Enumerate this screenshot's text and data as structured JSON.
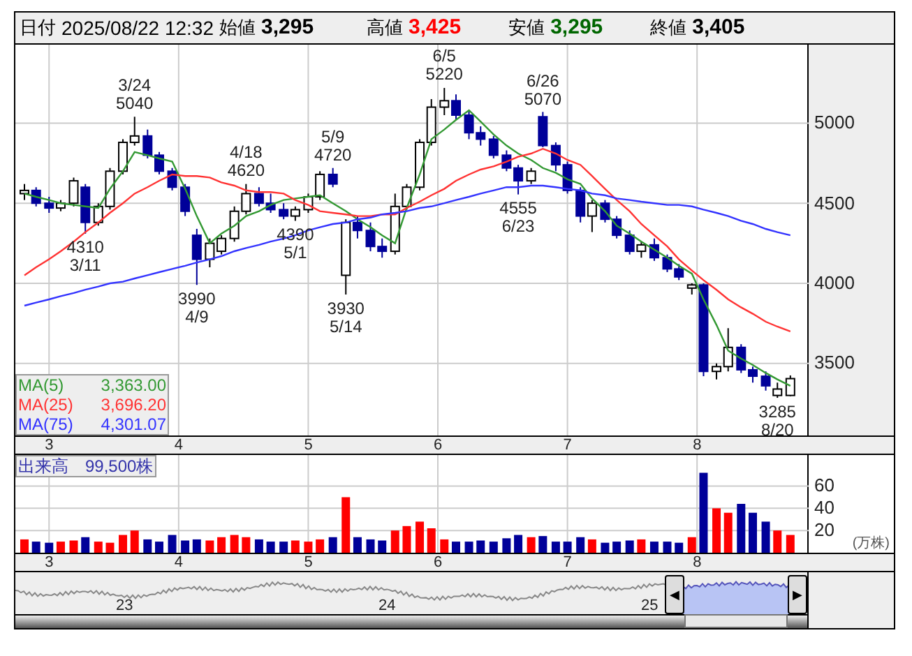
{
  "header": {
    "fields": [
      {
        "label": "日付",
        "value": "2025/08/22 12:32",
        "kind": "date"
      },
      {
        "label": "始値",
        "value": "3,295",
        "kind": "open"
      },
      {
        "label": "高値",
        "value": "3,425",
        "kind": "high"
      },
      {
        "label": "安値",
        "value": "3,295",
        "kind": "low"
      },
      {
        "label": "終値",
        "value": "3,405",
        "kind": "close"
      }
    ]
  },
  "price_chart": {
    "chart_data": {
      "type": "candlestick",
      "grid": true,
      "xlim": [
        2.74,
        9.54
      ],
      "ylim": [
        3050,
        5490
      ],
      "yticks": [
        3500,
        4000,
        4500,
        5000
      ],
      "xticks": [
        3,
        4,
        5,
        6,
        7,
        8
      ],
      "x": [
        2.81,
        2.9,
        3.0,
        3.09,
        3.19,
        3.28,
        3.38,
        3.47,
        3.57,
        3.66,
        3.76,
        3.85,
        3.95,
        4.05,
        4.14,
        4.24,
        4.33,
        4.43,
        4.52,
        4.62,
        4.71,
        4.81,
        4.9,
        5.0,
        5.09,
        5.19,
        5.29,
        5.38,
        5.48,
        5.57,
        5.67,
        5.76,
        5.86,
        5.95,
        6.05,
        6.14,
        6.24,
        6.33,
        6.43,
        6.53,
        6.62,
        6.72,
        6.81,
        6.91,
        7.0,
        7.1,
        7.19,
        7.29,
        7.38,
        7.48,
        7.57,
        7.67,
        7.77,
        7.86,
        7.96,
        8.05,
        8.15,
        8.24,
        8.34,
        8.43,
        8.53,
        8.62,
        8.72
      ],
      "ohlc": [
        [
          4560,
          4620,
          4520,
          4580
        ],
        [
          4580,
          4600,
          4480,
          4500
        ],
        [
          4500,
          4540,
          4440,
          4470
        ],
        [
          4470,
          4520,
          4450,
          4500
        ],
        [
          4500,
          4660,
          4480,
          4640
        ],
        [
          4600,
          4620,
          4310,
          4380
        ],
        [
          4380,
          4500,
          4360,
          4480
        ],
        [
          4480,
          4720,
          4460,
          4700
        ],
        [
          4700,
          4900,
          4680,
          4880
        ],
        [
          4880,
          5040,
          4860,
          4920
        ],
        [
          4920,
          4960,
          4780,
          4800
        ],
        [
          4800,
          4820,
          4680,
          4700
        ],
        [
          4700,
          4720,
          4580,
          4600
        ],
        [
          4600,
          4620,
          4420,
          4450
        ],
        [
          4300,
          4340,
          3990,
          4150
        ],
        [
          4150,
          4280,
          4100,
          4250
        ],
        [
          4200,
          4300,
          4180,
          4280
        ],
        [
          4280,
          4480,
          4260,
          4450
        ],
        [
          4450,
          4620,
          4430,
          4560
        ],
        [
          4560,
          4600,
          4480,
          4500
        ],
        [
          4500,
          4560,
          4440,
          4460
        ],
        [
          4460,
          4500,
          4400,
          4420
        ],
        [
          4420,
          4480,
          4390,
          4460
        ],
        [
          4460,
          4560,
          4440,
          4540
        ],
        [
          4540,
          4700,
          4520,
          4680
        ],
        [
          4680,
          4720,
          4600,
          4620
        ],
        [
          4050,
          4400,
          3930,
          4380
        ],
        [
          4380,
          4420,
          4280,
          4330
        ],
        [
          4330,
          4380,
          4200,
          4230
        ],
        [
          4230,
          4280,
          4160,
          4200
        ],
        [
          4200,
          4560,
          4180,
          4480
        ],
        [
          4480,
          4620,
          4460,
          4600
        ],
        [
          4600,
          4900,
          4580,
          4880
        ],
        [
          4880,
          5150,
          4860,
          5100
        ],
        [
          5100,
          5220,
          5050,
          5140
        ],
        [
          5140,
          5180,
          5020,
          5050
        ],
        [
          5050,
          5080,
          4900,
          4940
        ],
        [
          4940,
          4980,
          4860,
          4900
        ],
        [
          4900,
          4920,
          4780,
          4800
        ],
        [
          4800,
          4830,
          4700,
          4720
        ],
        [
          4720,
          4740,
          4555,
          4640
        ],
        [
          4640,
          4720,
          4620,
          4700
        ],
        [
          5040,
          5070,
          4850,
          4860
        ],
        [
          4860,
          4880,
          4700,
          4740
        ],
        [
          4740,
          4760,
          4560,
          4580
        ],
        [
          4580,
          4600,
          4380,
          4420
        ],
        [
          4420,
          4520,
          4320,
          4500
        ],
        [
          4500,
          4520,
          4380,
          4400
        ],
        [
          4400,
          4420,
          4280,
          4300
        ],
        [
          4300,
          4330,
          4180,
          4200
        ],
        [
          4200,
          4260,
          4160,
          4240
        ],
        [
          4240,
          4280,
          4140,
          4160
        ],
        [
          4160,
          4180,
          4070,
          4090
        ],
        [
          4090,
          4120,
          4020,
          4040
        ],
        [
          3970,
          4000,
          3930,
          3990
        ],
        [
          3990,
          4000,
          3420,
          3450
        ],
        [
          3450,
          3500,
          3400,
          3480
        ],
        [
          3480,
          3720,
          3450,
          3600
        ],
        [
          3600,
          3620,
          3440,
          3460
        ],
        [
          3460,
          3480,
          3380,
          3420
        ],
        [
          3420,
          3450,
          3330,
          3360
        ],
        [
          3300,
          3380,
          3285,
          3340
        ],
        [
          3300,
          3425,
          3295,
          3405
        ]
      ],
      "series": [
        {
          "name": "MA(5)",
          "type": "line",
          "color": "#339933",
          "values": [
            4560,
            4540,
            4520,
            4500,
            4490,
            4480,
            4470,
            4590,
            4700,
            4820,
            4800,
            4780,
            4760,
            4590,
            4420,
            4250,
            4310,
            4360,
            4420,
            4450,
            4490,
            4520,
            4530,
            4540,
            4550,
            4500,
            4450,
            4400,
            4350,
            4300,
            4250,
            4470,
            4680,
            4900,
            4960,
            5020,
            5080,
            5010,
            4930,
            4860,
            4810,
            4770,
            4720,
            4690,
            4650,
            4620,
            4530,
            4450,
            4360,
            4310,
            4260,
            4210,
            4160,
            4110,
            4060,
            3900,
            3740,
            3580,
            3530,
            3490,
            3440,
            3400,
            3360
          ]
        },
        {
          "name": "MA(25)",
          "type": "line",
          "color": "#ff3333",
          "values": [
            4050,
            4100,
            4150,
            4200,
            4260,
            4320,
            4380,
            4440,
            4500,
            4560,
            4600,
            4640,
            4680,
            4670,
            4670,
            4660,
            4630,
            4610,
            4580,
            4570,
            4570,
            4560,
            4520,
            4490,
            4450,
            4440,
            4430,
            4420,
            4420,
            4430,
            4430,
            4470,
            4510,
            4550,
            4590,
            4640,
            4680,
            4710,
            4730,
            4760,
            4790,
            4810,
            4840,
            4810,
            4770,
            4740,
            4670,
            4590,
            4520,
            4450,
            4370,
            4300,
            4230,
            4150,
            4080,
            4020,
            3960,
            3900,
            3850,
            3810,
            3760,
            3730,
            3700
          ]
        },
        {
          "name": "MA(75)",
          "type": "line",
          "color": "#3333ff",
          "values": [
            3860,
            3880,
            3900,
            3920,
            3940,
            3960,
            3980,
            4000,
            4010,
            4030,
            4050,
            4070,
            4090,
            4110,
            4130,
            4150,
            4170,
            4200,
            4220,
            4240,
            4260,
            4280,
            4300,
            4330,
            4350,
            4370,
            4380,
            4400,
            4410,
            4430,
            4440,
            4450,
            4470,
            4480,
            4500,
            4520,
            4540,
            4560,
            4580,
            4600,
            4600,
            4610,
            4610,
            4600,
            4590,
            4580,
            4560,
            4550,
            4530,
            4520,
            4510,
            4500,
            4490,
            4490,
            4480,
            4460,
            4440,
            4420,
            4390,
            4370,
            4340,
            4320,
            4300
          ]
        }
      ],
      "annotations": [
        "3/24",
        "5040",
        "4/18",
        "4620",
        "5/9",
        "4720",
        "6/5",
        "5220",
        "6/26",
        "5070",
        "4310",
        "3/11",
        "3990",
        "4/9",
        "4390",
        "5/1",
        "3930",
        "5/14",
        "4555",
        "6/23",
        "3285",
        "8/20"
      ]
    },
    "legend": [
      {
        "value": "3,363.00"
      },
      {
        "value": "3,696.20"
      },
      {
        "value": "4,301.07"
      }
    ]
  },
  "volume_chart": {
    "chart_data": {
      "type": "bar",
      "grid": true,
      "xlim": [
        2.74,
        9.54
      ],
      "ylim": [
        0,
        88
      ],
      "yticks": [
        20,
        40,
        60
      ],
      "xticks": [
        3,
        4,
        5,
        6,
        7,
        8
      ],
      "x": [
        2.81,
        2.9,
        3.0,
        3.09,
        3.19,
        3.28,
        3.38,
        3.47,
        3.57,
        3.66,
        3.76,
        3.85,
        3.95,
        4.05,
        4.14,
        4.24,
        4.33,
        4.43,
        4.52,
        4.62,
        4.71,
        4.81,
        4.9,
        5.0,
        5.09,
        5.19,
        5.29,
        5.38,
        5.48,
        5.57,
        5.67,
        5.76,
        5.86,
        5.95,
        6.05,
        6.14,
        6.24,
        6.33,
        6.43,
        6.53,
        6.62,
        6.72,
        6.81,
        6.91,
        7.0,
        7.1,
        7.19,
        7.29,
        7.38,
        7.48,
        7.57,
        7.67,
        7.77,
        7.86,
        7.96,
        8.05,
        8.15,
        8.24,
        8.34,
        8.43,
        8.53,
        8.62,
        8.72
      ],
      "values": [
        12,
        10,
        9,
        10,
        11,
        14,
        10,
        9,
        16,
        20,
        12,
        10,
        16,
        11,
        12,
        11,
        14,
        16,
        14,
        12,
        10,
        10,
        11,
        10,
        12,
        14,
        50,
        14,
        12,
        11,
        20,
        24,
        28,
        22,
        12,
        10,
        10,
        11,
        10,
        13,
        16,
        14,
        15,
        10,
        10,
        14,
        12,
        9,
        10,
        11,
        12,
        10,
        10,
        9,
        14,
        72,
        40,
        36,
        44,
        36,
        28,
        20,
        16
      ]
    },
    "legend": {
      "label": "出来高",
      "value": "99,500株"
    },
    "unit": "(万株)"
  },
  "navigator": {
    "labels": [
      "23",
      "24",
      "25"
    ],
    "left_handle": "◀",
    "right_handle": "▶"
  }
}
